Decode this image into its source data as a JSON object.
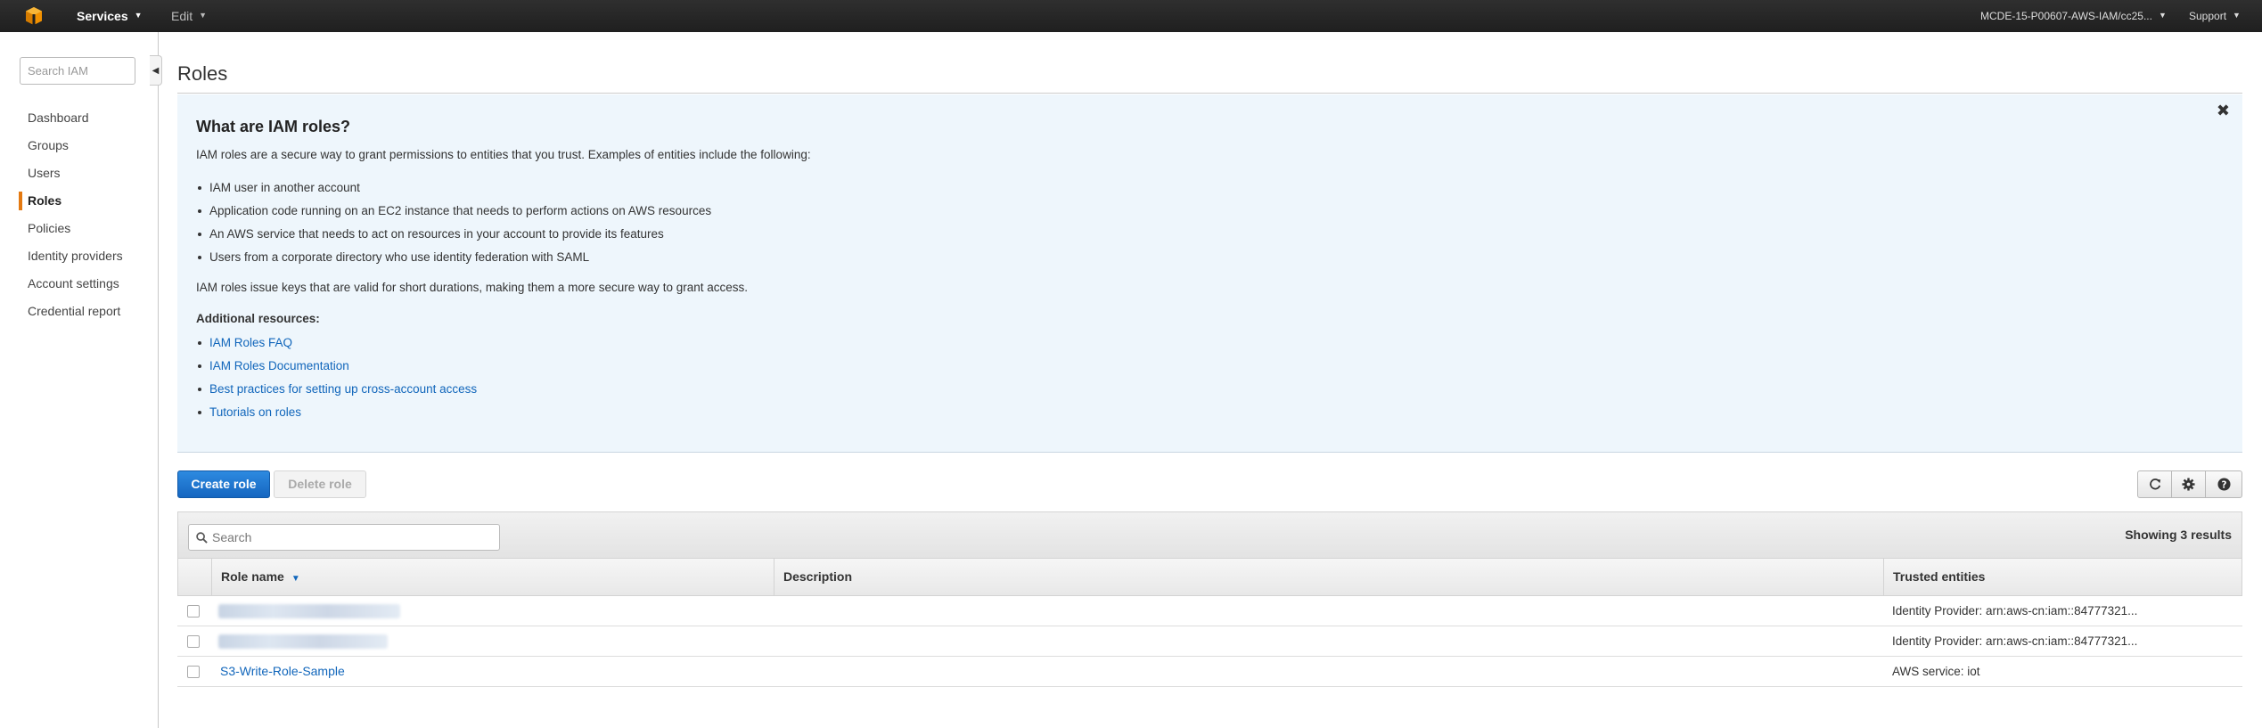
{
  "topbar": {
    "services_label": "Services",
    "edit_label": "Edit",
    "account_label": "MCDE-15-P00607-AWS-IAM/cc25...",
    "support_label": "Support"
  },
  "sidebar": {
    "search_placeholder": "Search IAM",
    "items": [
      {
        "label": "Dashboard"
      },
      {
        "label": "Groups"
      },
      {
        "label": "Users"
      },
      {
        "label": "Roles"
      },
      {
        "label": "Policies"
      },
      {
        "label": "Identity providers"
      },
      {
        "label": "Account settings"
      },
      {
        "label": "Credential report"
      }
    ],
    "active_item": "Roles"
  },
  "page": {
    "title": "Roles"
  },
  "info": {
    "heading": "What are IAM roles?",
    "intro": "IAM roles are a secure way to grant permissions to entities that you trust. Examples of entities include the following:",
    "entities": [
      "IAM user in another account",
      "Application code running on an EC2 instance that needs to perform actions on AWS resources",
      "An AWS service that needs to act on resources in your account to provide its features",
      "Users from a corporate directory who use identity federation with SAML"
    ],
    "note": "IAM roles issue keys that are valid for short durations, making them a more secure way to grant access.",
    "resources_heading": "Additional resources:",
    "resources": [
      "IAM Roles FAQ",
      "IAM Roles Documentation",
      "Best practices for setting up cross-account access",
      "Tutorials on roles"
    ]
  },
  "actions": {
    "create_label": "Create role",
    "delete_label": "Delete role"
  },
  "table": {
    "search_placeholder": "Search",
    "results_text": "Showing 3 results",
    "columns": {
      "name": "Role name",
      "description": "Description",
      "trusted": "Trusted entities"
    },
    "rows": [
      {
        "name": "",
        "description": "",
        "trusted": "Identity Provider: arn:aws-cn:iam::84777321..."
      },
      {
        "name": "",
        "description": "",
        "trusted": "Identity Provider: arn:aws-cn:iam::84777321..."
      },
      {
        "name": "S3-Write-Role-Sample",
        "description": "",
        "trusted": "AWS service: iot"
      }
    ]
  },
  "colors": {
    "accent_orange": "#e47911",
    "link_blue": "#1166bb",
    "primary_button": "#1a73d1",
    "info_panel_bg": "#eef6fc",
    "topbar_bg": "#262626"
  }
}
